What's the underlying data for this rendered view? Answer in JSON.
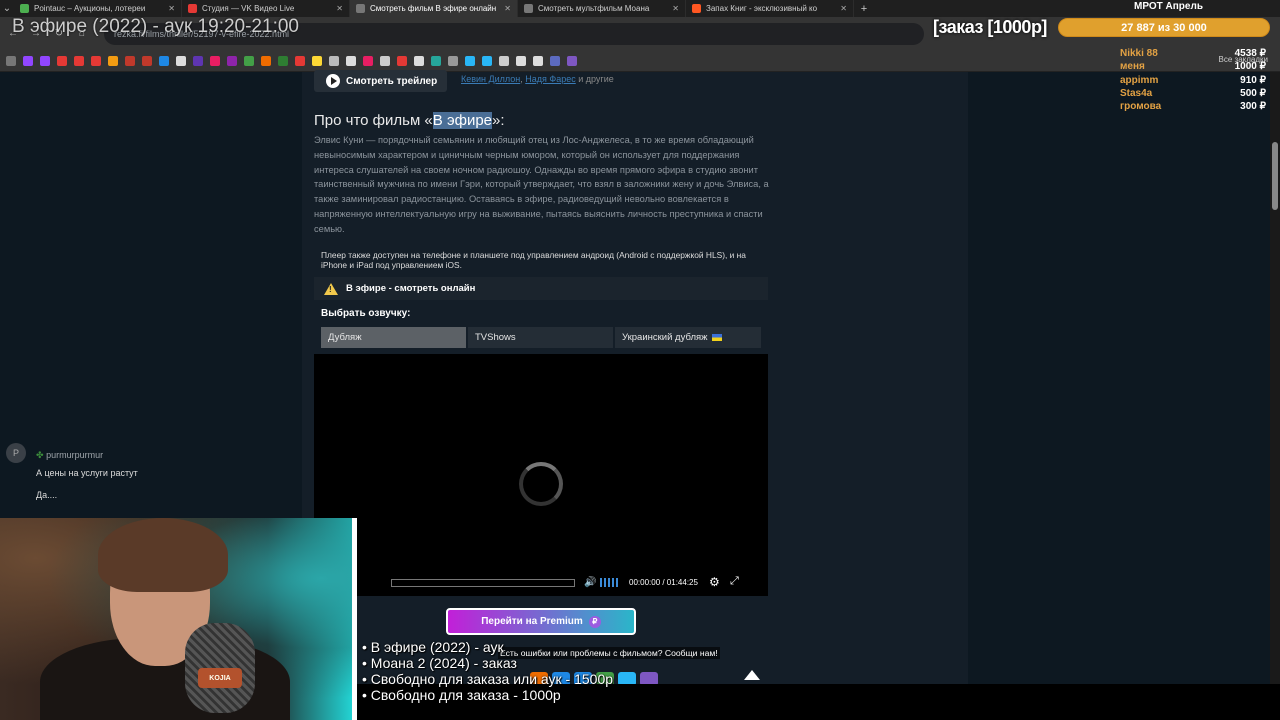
{
  "tabs": [
    {
      "title": "Pointauc – Аукционы, лотереи",
      "color": "#4caf50",
      "active": false
    },
    {
      "title": "Студия — VK Видео Live",
      "color": "#e53935",
      "active": false
    },
    {
      "title": "Смотреть фильм В эфире онлайн",
      "color": "#888888",
      "active": true
    },
    {
      "title": "Смотреть мультфильм Моана",
      "color": "#888888",
      "active": false
    },
    {
      "title": "Запах Книг - эксклюзивный ко",
      "color": "#ff5722",
      "active": false
    }
  ],
  "address": "rezka.fi/films/thriller/52197-v-efire-2022.html",
  "bookmarks_all": "Все закладки",
  "page": {
    "trailer_button": "Смотреть трейлер",
    "actors": {
      "a1": "Кевин Диллон",
      "sep": ", ",
      "a2": "Надя Фарес",
      "rest": " и другие"
    },
    "about_prefix": "Про что фильм «",
    "about_highlight": "В эфире",
    "about_suffix": "»:",
    "about_text": "Элвис Куни — порядочный семьянин и любящий отец из Лос-Анджелеса, в то же время обладающий невыносимым характером и циничным черным юмором, который он использует для поддержания интереса слушателей на своем ночном радиошоу. Однажды во время прямого эфира в студию звонит таинственный мужчина по имени Гэри, который утверждает, что взял в заложники жену и дочь Элвиса, а также заминировал радиостанцию. Оставаясь в эфире, радиоведущий невольно вовлекается в напряженную интеллектуальную игру на выживание, пытаясь выяснить личность преступника и спасти семью.",
    "player_note": "Плеер также доступен на телефоне и планшете под управлением андроид (Android с поддержкой HLS), и на iPhone и iPad под управлением iOS.",
    "watch_title": "В эфире - смотреть онлайн",
    "voice_label": "Выбрать озвучку:",
    "voices": [
      "Дубляж",
      "TVShows",
      "Украинский дубляж"
    ],
    "time": "00:00:00 / 01:44:25",
    "premium": "Перейти на Premium",
    "report": "Есть ошибки или проблемы с фильмом? Сообщи нам!"
  },
  "chat": {
    "avatar_letter": "P",
    "user": "purmurpurmur",
    "msg1": "А цены на услуги растут",
    "msg2": "Да...."
  },
  "overlay": {
    "title": "В эфире (2022) - аук 19:20-21:00",
    "order": "[заказ [1000р]",
    "goal_title": "МРОТ Апрель",
    "goal_text": "27 887  из 30 000",
    "donors": [
      {
        "name": "Nikki 88",
        "amount": "4538 ₽"
      },
      {
        "name": "меня",
        "amount": "1000 ₽"
      },
      {
        "name": "appimm",
        "amount": "910 ₽"
      },
      {
        "name": "Stas4a",
        "amount": "500 ₽"
      },
      {
        "name": "громова",
        "amount": "300 ₽"
      }
    ],
    "list": [
      "• В эфире (2022) - аук",
      "• Моана 2 (2024) - заказ",
      "• Свободно для заказа или аук - 1500р",
      "• Свободно для заказа - 1000р"
    ],
    "mic_label": "KOJIA"
  },
  "colors": {
    "accent_gold": "#e0a02d",
    "donor_name": "#e3a244",
    "premium_start": "#c21fd8",
    "premium_end": "#2ab6c9"
  }
}
